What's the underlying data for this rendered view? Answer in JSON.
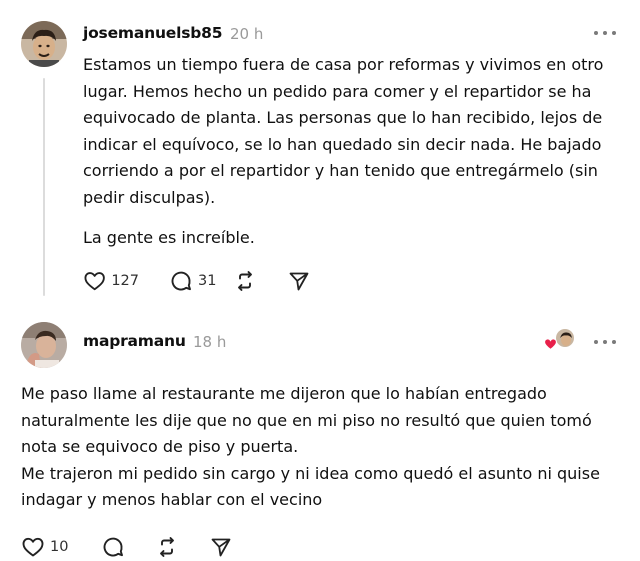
{
  "posts": [
    {
      "username": "josemanuelsb85",
      "time": "20 h",
      "paragraphs": [
        "Estamos un tiempo fuera de casa por reformas y vivimos en otro lugar. Hemos hecho un pedido para comer y el repartidor se ha equivocado de planta. Las personas que lo han recibido, lejos de indicar el equívoco, se lo han quedado sin decir nada. He bajado corriendo a por el repartidor y han tenido que entregármelo (sin pedir disculpas).",
        "La gente es increíble."
      ],
      "likes": "127",
      "replies": "31"
    },
    {
      "username": "mapramanu",
      "time": "18 h",
      "text": "Me paso llame al restaurante me dijeron que lo habían entregado naturalmente les dije que no que en mi piso no resultó que quien tomó nota se equivoco de piso y puerta.\nMe trajeron mi pedido sin cargo y ni idea como quedó el asunto ni quise indagar y menos hablar con el vecino",
      "likes": "10"
    }
  ],
  "icons": {
    "like": "heart-icon",
    "reply": "comment-icon",
    "repost": "repost-icon",
    "share": "send-icon",
    "more": "more-dots-icon",
    "liked_by_author": "red-heart-icon"
  },
  "colors": {
    "text": "#101010",
    "muted": "#9a9a9a",
    "icon": "#222222",
    "liked_heart": "#e8204a",
    "thread_line": "#dcdcdc"
  }
}
